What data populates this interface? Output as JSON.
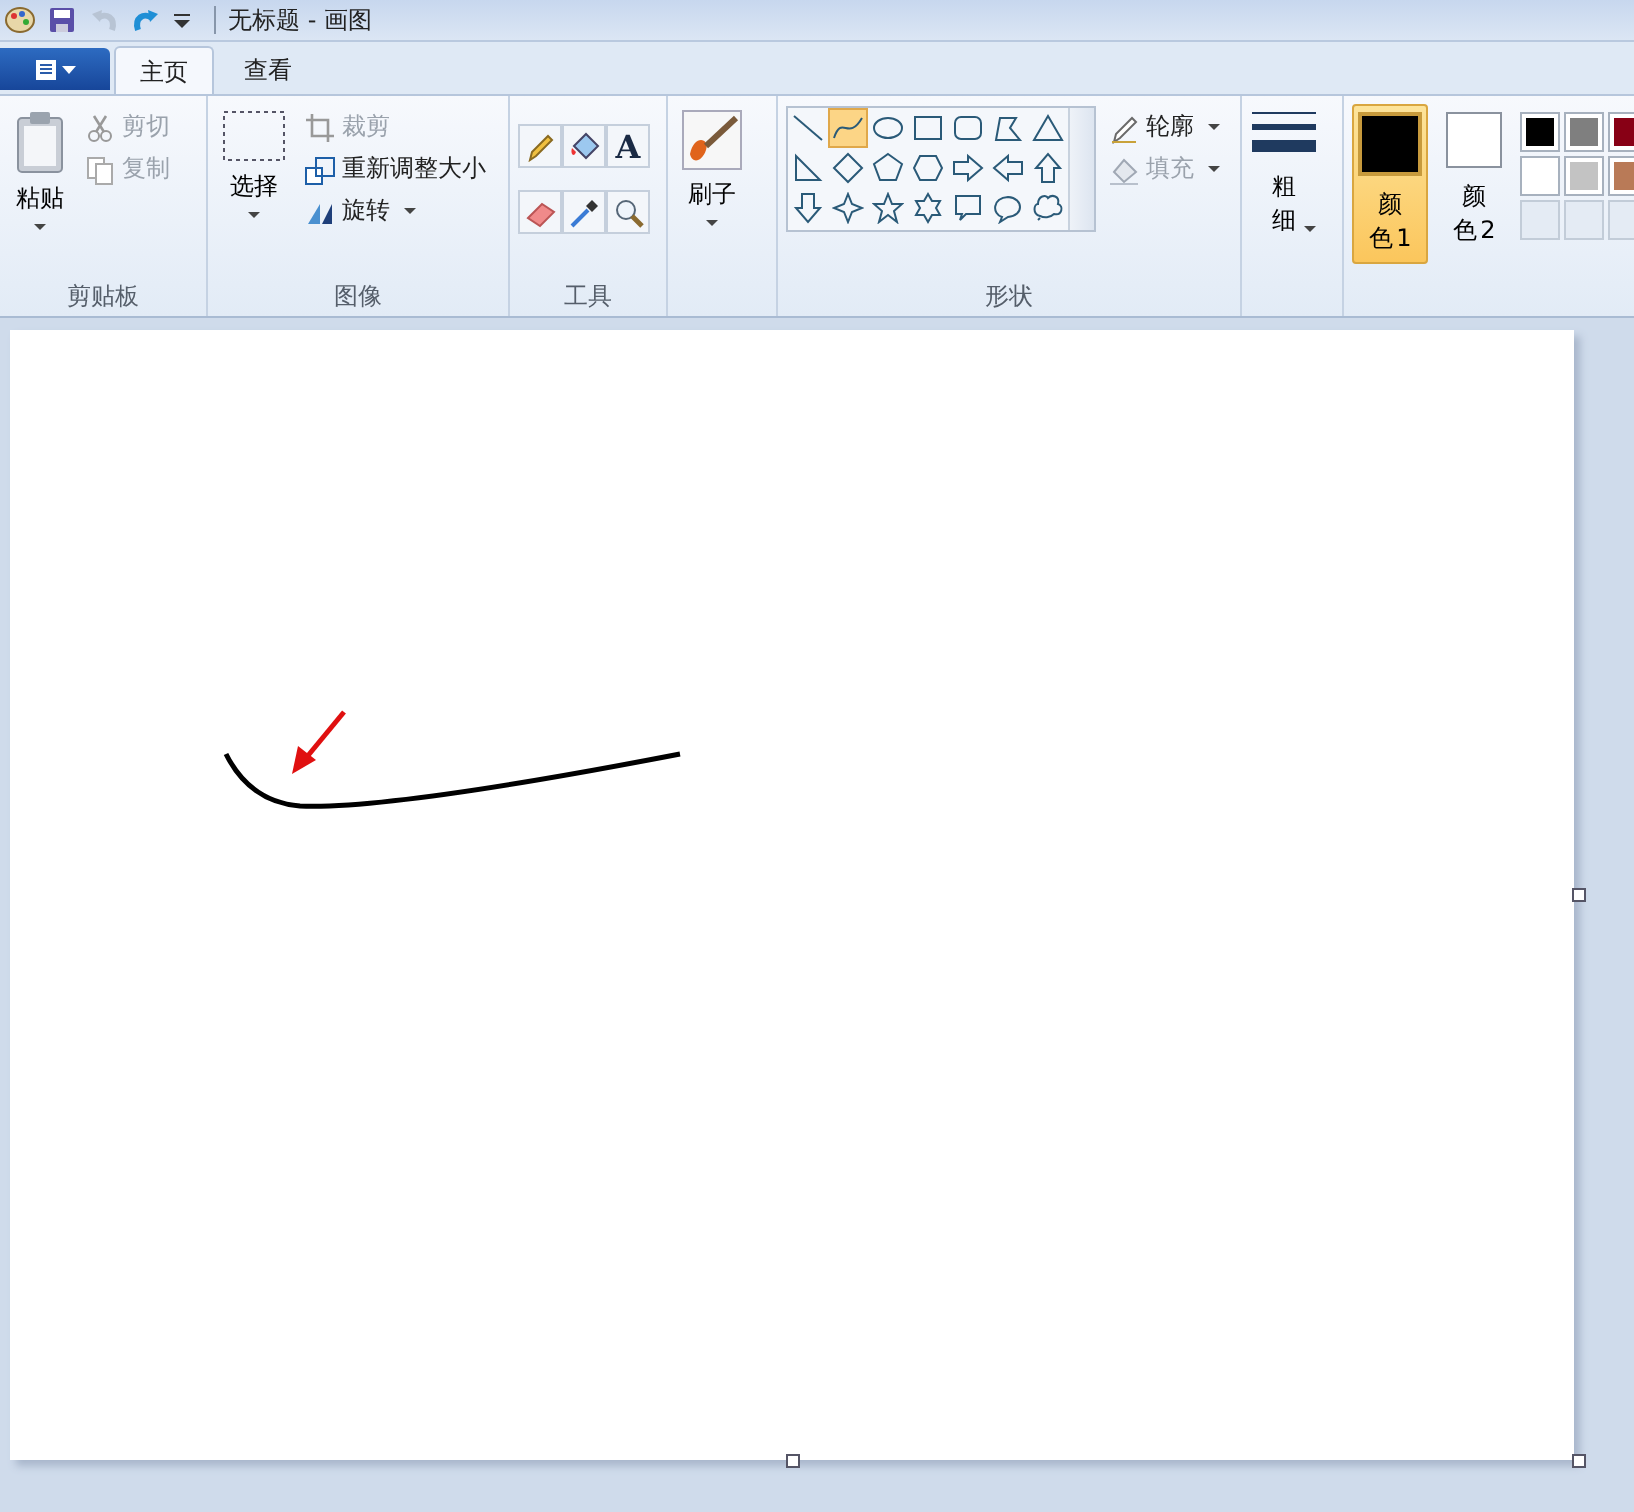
{
  "window": {
    "title": "无标题 - 画图"
  },
  "tabs": [
    {
      "label": "主页",
      "selected": true
    },
    {
      "label": "查看",
      "selected": false
    }
  ],
  "clipboard": {
    "label": "剪贴板",
    "paste": "粘贴",
    "cut": {
      "label": "剪切",
      "disabled": true
    },
    "copy": {
      "label": "复制",
      "disabled": true
    }
  },
  "image": {
    "label": "图像",
    "select": "选择",
    "crop": {
      "label": "裁剪",
      "disabled": true
    },
    "resize": {
      "label": "重新调整大小",
      "disabled": false
    },
    "rotate": {
      "label": "旋转",
      "disabled": false
    }
  },
  "tools": {
    "label": "工具",
    "items": [
      {
        "kind": "pencil"
      },
      {
        "kind": "fill"
      },
      {
        "kind": "text",
        "glyph": "A"
      },
      {
        "kind": "eraser"
      },
      {
        "kind": "picker"
      },
      {
        "kind": "magnifier"
      }
    ]
  },
  "brush": {
    "label": "刷子"
  },
  "shapes": {
    "label": "形状",
    "items": [
      {
        "kind": "line",
        "selected": false
      },
      {
        "kind": "curve",
        "selected": true
      },
      {
        "kind": "oval",
        "selected": false
      },
      {
        "kind": "rect",
        "selected": false
      },
      {
        "kind": "roundrect",
        "selected": false
      },
      {
        "kind": "polygon",
        "selected": false
      },
      {
        "kind": "triangle",
        "selected": false
      },
      {
        "kind": "right-triangle",
        "selected": false
      },
      {
        "kind": "diamond",
        "selected": false
      },
      {
        "kind": "pentagon",
        "selected": false
      },
      {
        "kind": "hexagon",
        "selected": false
      },
      {
        "kind": "arrow-right",
        "selected": false
      },
      {
        "kind": "arrow-left",
        "selected": false
      },
      {
        "kind": "arrow-up",
        "selected": false
      },
      {
        "kind": "arrow-down",
        "selected": false
      },
      {
        "kind": "star4",
        "selected": false
      },
      {
        "kind": "star5",
        "selected": false
      },
      {
        "kind": "star6",
        "selected": false
      },
      {
        "kind": "callout-rect",
        "selected": false
      },
      {
        "kind": "callout-oval",
        "selected": false
      },
      {
        "kind": "callout-cloud",
        "selected": false
      }
    ],
    "outline": {
      "label": "轮廓",
      "disabled": false
    },
    "fill": {
      "label": "填充",
      "disabled": true
    }
  },
  "size": {
    "label": "粗细"
  },
  "colors": [
    {
      "label": "颜色 1",
      "selected": true,
      "color": "#000000"
    },
    {
      "label": "颜色 2",
      "selected": false,
      "color": "#ffffff"
    }
  ],
  "palette": [
    {
      "kind": "swatch",
      "color": "#000000"
    },
    {
      "kind": "swatch",
      "color": "#7f7f7f"
    },
    {
      "kind": "swatch",
      "color": "#880015"
    },
    {
      "kind": "swatch",
      "color": "#ffffff"
    },
    {
      "kind": "swatch",
      "color": "#c3c3c3"
    },
    {
      "kind": "swatch",
      "color": "#b97a57"
    },
    {
      "kind": "empty"
    },
    {
      "kind": "empty"
    },
    {
      "kind": "empty"
    }
  ]
}
